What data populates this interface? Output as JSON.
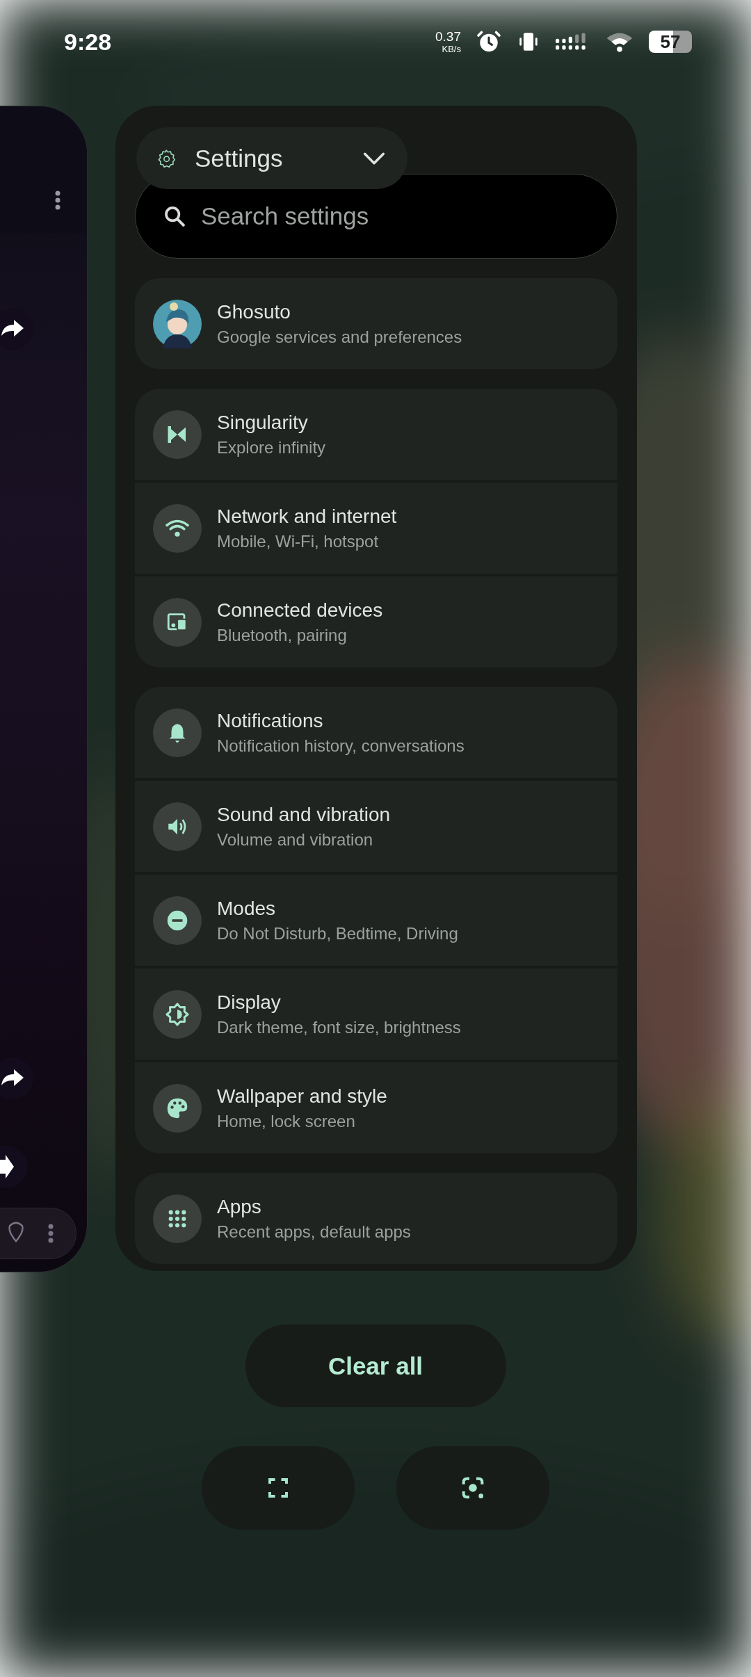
{
  "status_bar": {
    "time": "9:28",
    "net_speed": "0.37",
    "net_unit": "KB/s",
    "battery": "57"
  },
  "app_chip": {
    "title": "Settings"
  },
  "search": {
    "placeholder": "Search settings"
  },
  "groups": [
    {
      "items": [
        {
          "kind": "avatar",
          "title": "Ghosuto",
          "subtitle": "Google services and preferences"
        }
      ]
    },
    {
      "items": [
        {
          "kind": "singularity",
          "title": "Singularity",
          "subtitle": "Explore infinity"
        },
        {
          "kind": "wifi",
          "title": "Network and internet",
          "subtitle": "Mobile, Wi-Fi, hotspot"
        },
        {
          "kind": "devices",
          "title": "Connected devices",
          "subtitle": "Bluetooth, pairing"
        }
      ]
    },
    {
      "items": [
        {
          "kind": "bell",
          "title": "Notifications",
          "subtitle": "Notification history, conversations"
        },
        {
          "kind": "sound",
          "title": "Sound and vibration",
          "subtitle": "Volume and vibration"
        },
        {
          "kind": "modes",
          "title": "Modes",
          "subtitle": "Do Not Disturb, Bedtime, Driving"
        },
        {
          "kind": "display",
          "title": "Display",
          "subtitle": "Dark theme, font size, brightness"
        },
        {
          "kind": "palette",
          "title": "Wallpaper and style",
          "subtitle": "Home, lock screen"
        }
      ]
    },
    {
      "items": [
        {
          "kind": "apps",
          "title": "Apps",
          "subtitle": "Recent apps, default apps"
        }
      ]
    }
  ],
  "clear_all": {
    "label": "Clear all"
  }
}
